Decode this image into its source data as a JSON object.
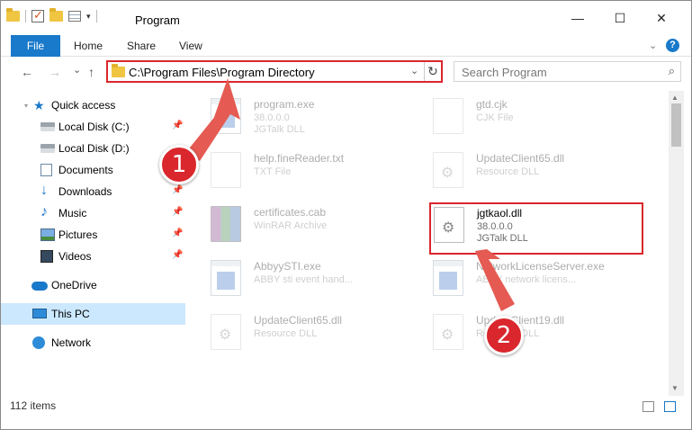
{
  "window": {
    "title": "Program",
    "minimize": "—",
    "maximize": "☐",
    "close": "✕"
  },
  "ribbon": {
    "tabs": [
      "File",
      "Home",
      "Share",
      "View"
    ]
  },
  "address": {
    "path": "C:\\Program Files\\Program Directory",
    "refresh": "↻",
    "dropdown": "⌄"
  },
  "search": {
    "placeholder": "Search Program",
    "icon": "search-icon"
  },
  "nav": {
    "back": "←",
    "forward": "→",
    "recent": "⌄",
    "up": "↑"
  },
  "sidebar": {
    "items": [
      {
        "label": "Quick access",
        "icon": "star-icon"
      },
      {
        "label": "Local Disk (C:)",
        "icon": "disk-icon",
        "pinned": true
      },
      {
        "label": "Local Disk (D:)",
        "icon": "disk-icon",
        "pinned": false
      },
      {
        "label": "Documents",
        "icon": "documents-icon",
        "pinned": true
      },
      {
        "label": "Downloads",
        "icon": "downloads-icon",
        "pinned": true
      },
      {
        "label": "Music",
        "icon": "music-icon",
        "pinned": true
      },
      {
        "label": "Pictures",
        "icon": "pictures-icon",
        "pinned": true
      },
      {
        "label": "Videos",
        "icon": "videos-icon",
        "pinned": true
      },
      {
        "label": "OneDrive",
        "icon": "onedrive-icon"
      },
      {
        "label": "This PC",
        "icon": "this-pc-icon",
        "selected": true
      },
      {
        "label": "Network",
        "icon": "network-icon"
      }
    ]
  },
  "files": [
    {
      "name": "program.exe",
      "line1": "38.0.0.0",
      "line2": "JGTalk DLL",
      "icon": "exe-icon"
    },
    {
      "name": "gtd.cjk",
      "line1": "CJK File",
      "line2": "",
      "icon": "document-icon"
    },
    {
      "name": "help.fineReader.txt",
      "line1": "TXT File",
      "line2": "",
      "icon": "document-icon"
    },
    {
      "name": "UpdateClient65.dll",
      "line1": "Resource DLL",
      "line2": "",
      "icon": "dll-icon"
    },
    {
      "name": "certificates.cab",
      "line1": "WinRAR Archive",
      "line2": "",
      "icon": "archive-icon"
    },
    {
      "name": "jgtkaol.dll",
      "line1": "38.0.0.0",
      "line2": "JGTalk DLL",
      "icon": "dll-icon"
    },
    {
      "name": "AbbyySTI.exe",
      "line1": "ABBY sti event hand...",
      "line2": "",
      "icon": "exe-icon"
    },
    {
      "name": "NetworkLicenseServer.exe",
      "line1": "ABBY network licens...",
      "line2": "",
      "icon": "exe-icon"
    },
    {
      "name": "UpdateClient65.dll",
      "line1": "Resource DLL",
      "line2": "",
      "icon": "dll-icon"
    },
    {
      "name": "UpdateClient19.dll",
      "line1": "Resource DLL",
      "line2": "",
      "icon": "dll-icon"
    }
  ],
  "status": {
    "count": "112 items"
  },
  "callouts": {
    "one": "1",
    "two": "2"
  },
  "colors": {
    "accent": "#1979ca",
    "highlight": "#d9272d",
    "selection": "#cce8ff"
  }
}
